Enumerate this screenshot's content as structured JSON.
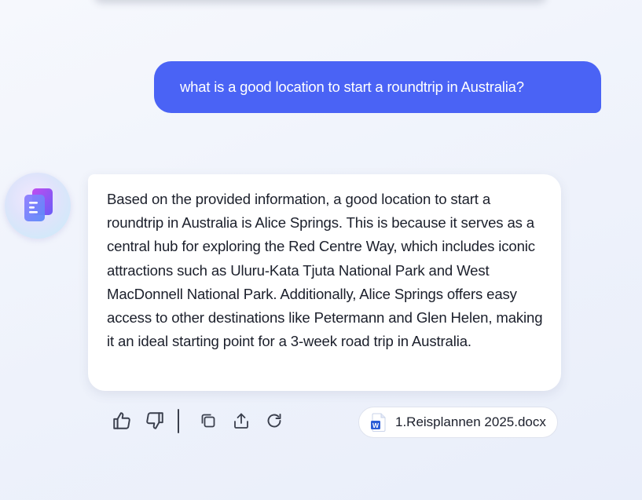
{
  "conversation": {
    "user_message": "what is a good location to start a roundtrip in Australia?",
    "assistant_message": "Based on the provided information, a good location to start a roundtrip in Australia is Alice Springs. This is because it serves as a central hub for exploring the Red Centre Way, which includes iconic attractions such as Uluru-Kata Tjuta National Park and West MacDonnell National Park. Additionally, Alice Springs offers easy access to other destinations like Petermann and Glen Helen, making it an ideal starting point for a 3-week road trip in Australia."
  },
  "actions": {
    "icons": [
      "thumbs-up-icon",
      "thumbs-down-icon",
      "copy-icon",
      "share-icon",
      "regenerate-icon"
    ]
  },
  "source_file": {
    "name": "1.Reisplannen 2025.docx",
    "icon": "word-doc-icon"
  },
  "colors": {
    "user_bubble": "#4a63f5",
    "assistant_bubble": "#ffffff",
    "background": "#eef2fb",
    "text": "#1b1f2b",
    "icon": "#3a3f4d",
    "word_blue": "#2b5dd6"
  }
}
